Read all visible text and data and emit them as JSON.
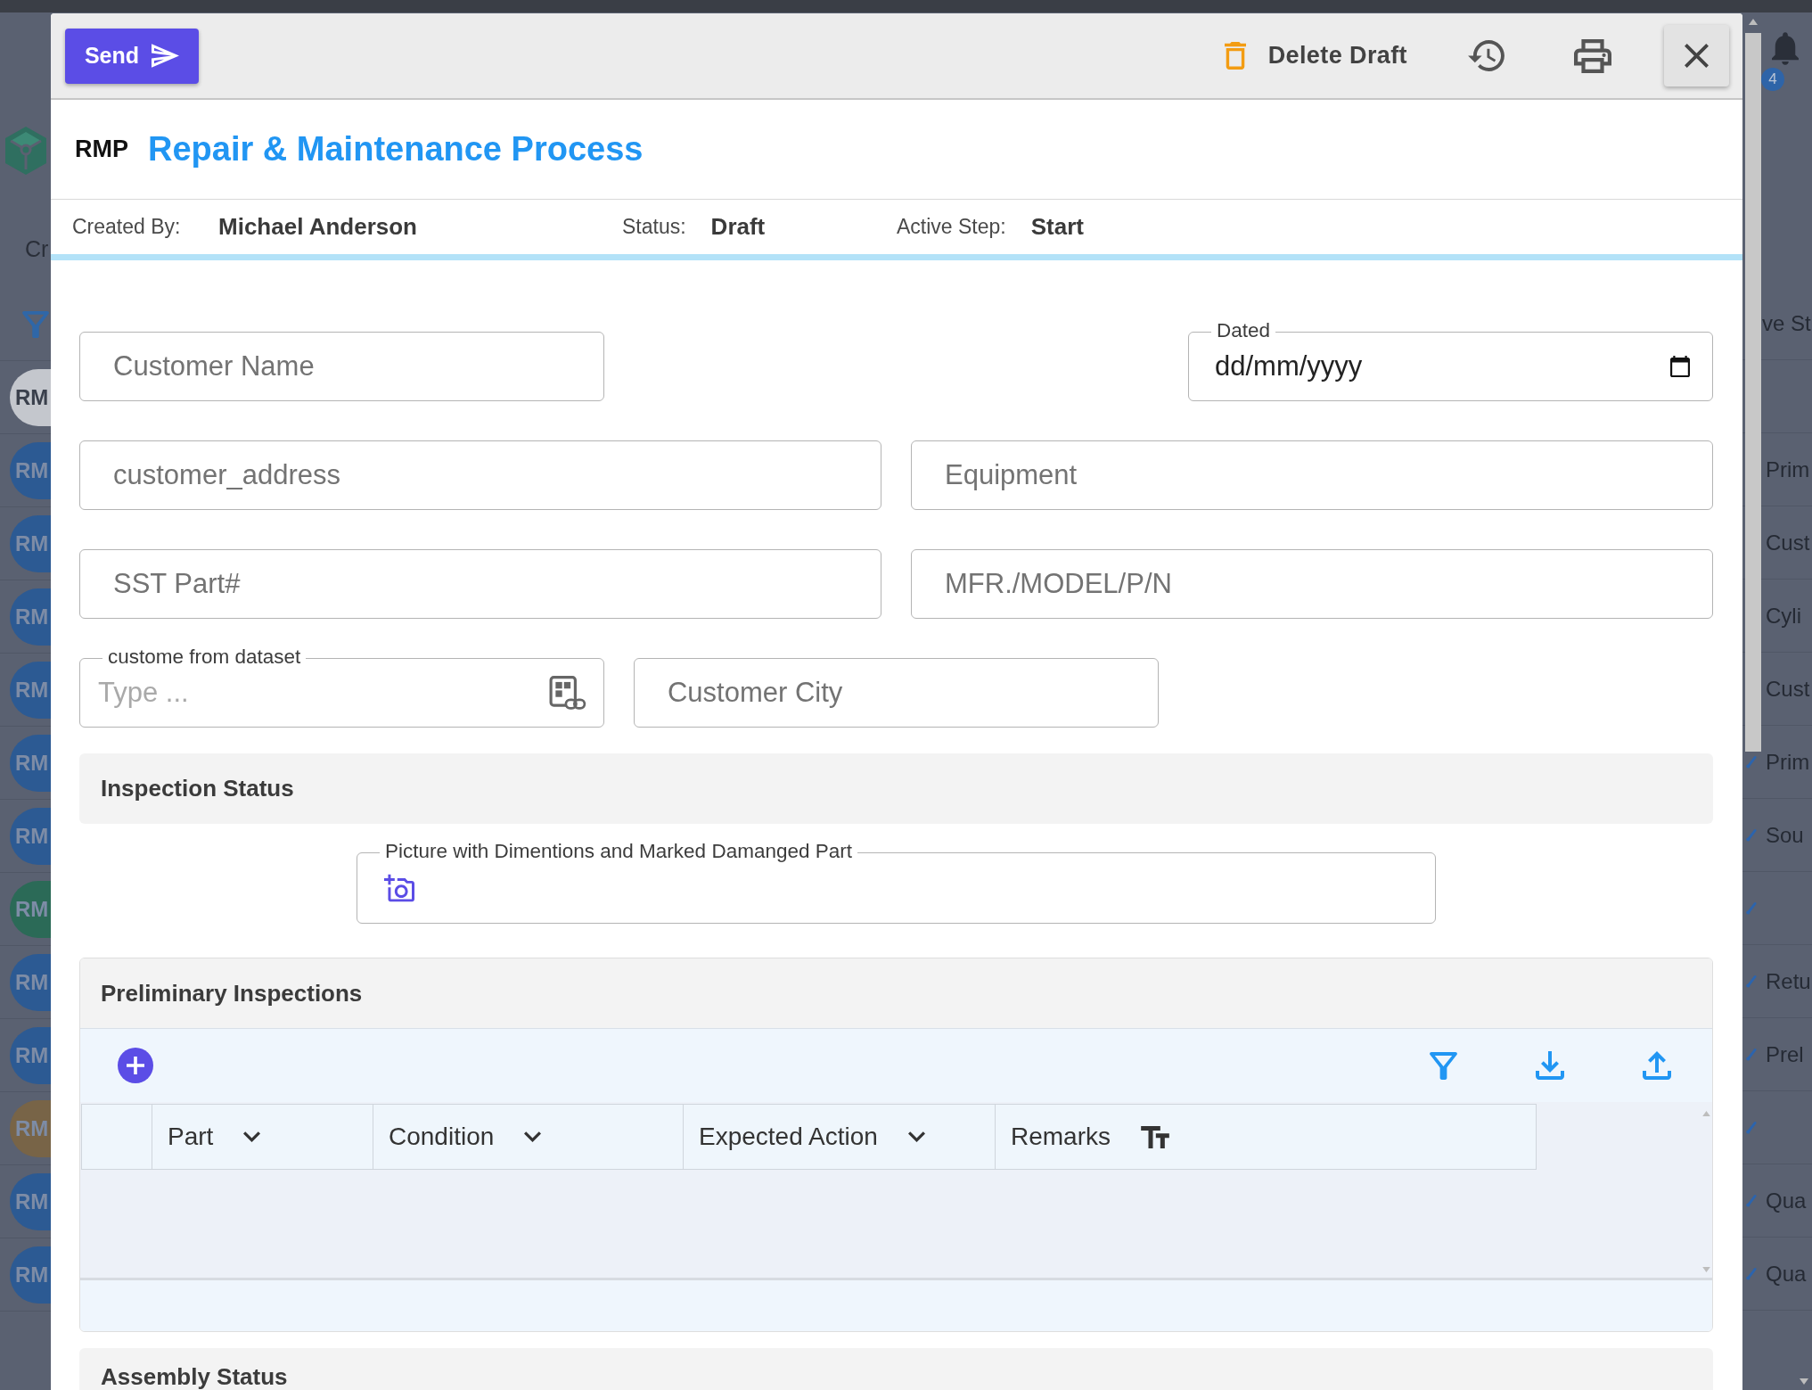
{
  "background": {
    "sidebar_label": "Cr",
    "column_header": "ve St",
    "notification_count": "4",
    "rows": [
      {
        "avatar": "RM",
        "color": "#c4c7cd",
        "icon": false
      },
      {
        "avatar": "RM",
        "color": "#2c5a93",
        "step": "Prim",
        "icon": false
      },
      {
        "avatar": "RM",
        "color": "#2c5a93",
        "step": "Cust",
        "icon": false
      },
      {
        "avatar": "RM",
        "color": "#2c5a93",
        "step": "Cyli",
        "icon": false
      },
      {
        "avatar": "RM",
        "color": "#2c5a93",
        "step": "Cust",
        "icon": false
      },
      {
        "avatar": "RM",
        "color": "#2c5a93",
        "step": "Prim",
        "icon": true
      },
      {
        "avatar": "RM",
        "color": "#2c5a93",
        "step": "Sou",
        "icon": true
      },
      {
        "avatar": "RM",
        "color": "#2b6a57",
        "icon": true
      },
      {
        "avatar": "RM",
        "color": "#2c5a93",
        "step": "Retu",
        "icon": true
      },
      {
        "avatar": "RM",
        "color": "#2c5a93",
        "step": "Prel",
        "icon": true
      },
      {
        "avatar": "RM",
        "color": "#786447",
        "icon": true
      },
      {
        "avatar": "RM",
        "color": "#2c5a93",
        "step": "Qua",
        "icon": true
      },
      {
        "avatar": "RM",
        "color": "#2c5a93",
        "step": "Qua",
        "icon": true
      }
    ]
  },
  "toolbar": {
    "send_label": "Send",
    "delete_label": "Delete Draft"
  },
  "header": {
    "code": "RMP",
    "title": "Repair & Maintenance Process"
  },
  "info": [
    {
      "label": "Created By:",
      "value": "Michael Anderson"
    },
    {
      "label": "Status:",
      "value": "Draft"
    },
    {
      "label": "Active Step:",
      "value": "Start"
    }
  ],
  "form_rows": [
    [
      {
        "kind": "text",
        "placeholder": "Customer Name"
      },
      {
        "kind": "date",
        "label": "Dated",
        "value": "dd/mm/yyyy"
      }
    ],
    [
      {
        "kind": "text",
        "placeholder": "customer_address"
      },
      {
        "kind": "text",
        "placeholder": "Equipment"
      }
    ],
    [
      {
        "kind": "text",
        "placeholder": "SST Part#"
      },
      {
        "kind": "text",
        "placeholder": "MFR./MODEL/P/N"
      }
    ],
    [
      {
        "kind": "lookup",
        "label": "custome from dataset",
        "placeholder": "Type ..."
      },
      {
        "kind": "text",
        "placeholder": "Customer City"
      }
    ]
  ],
  "sections": [
    {
      "kind": "fields",
      "title": "Inspection Status",
      "fields": [
        {
          "kind": "image",
          "label": "Picture with Dimentions and Marked Damanged Part"
        }
      ]
    },
    {
      "kind": "grid",
      "title": "Preliminary Inspections",
      "columns": [
        {
          "kind": "select",
          "label": "Part"
        },
        {
          "kind": "select",
          "label": "Condition"
        },
        {
          "kind": "select",
          "label": "Expected Action"
        },
        {
          "kind": "text",
          "label": "Remarks"
        }
      ]
    },
    {
      "kind": "fields",
      "title": "Assembly Status"
    }
  ]
}
